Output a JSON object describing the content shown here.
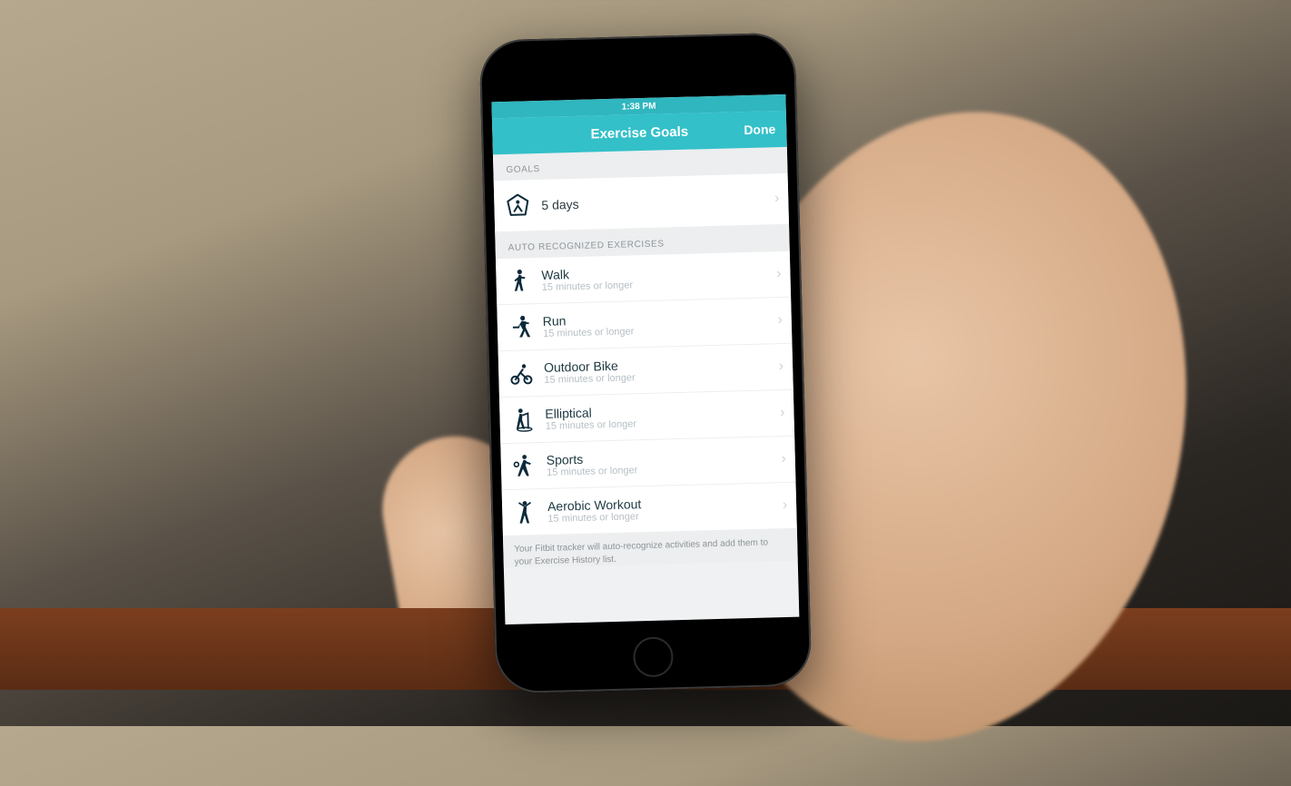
{
  "statusbar": {
    "time": "1:38 PM"
  },
  "header": {
    "title": "Exercise Goals",
    "done_label": "Done"
  },
  "sections": {
    "goals_header": "GOALS",
    "goals_item": {
      "label": "5 days"
    },
    "auto_header": "AUTO RECOGNIZED EXERCISES"
  },
  "exercises": [
    {
      "name": "walk",
      "title": "Walk",
      "sub": "15 minutes or longer"
    },
    {
      "name": "run",
      "title": "Run",
      "sub": "15 minutes or longer"
    },
    {
      "name": "bike",
      "title": "Outdoor Bike",
      "sub": "15 minutes or longer"
    },
    {
      "name": "elliptical",
      "title": "Elliptical",
      "sub": "15 minutes or longer"
    },
    {
      "name": "sports",
      "title": "Sports",
      "sub": "15 minutes or longer"
    },
    {
      "name": "aerobic",
      "title": "Aerobic Workout",
      "sub": "15 minutes or longer"
    }
  ],
  "footer_note": "Your Fitbit tracker will auto-recognize activities and add them to your Exercise History list.",
  "colors": {
    "accent": "#33c0c9",
    "statusbar": "#2fb6bf"
  }
}
